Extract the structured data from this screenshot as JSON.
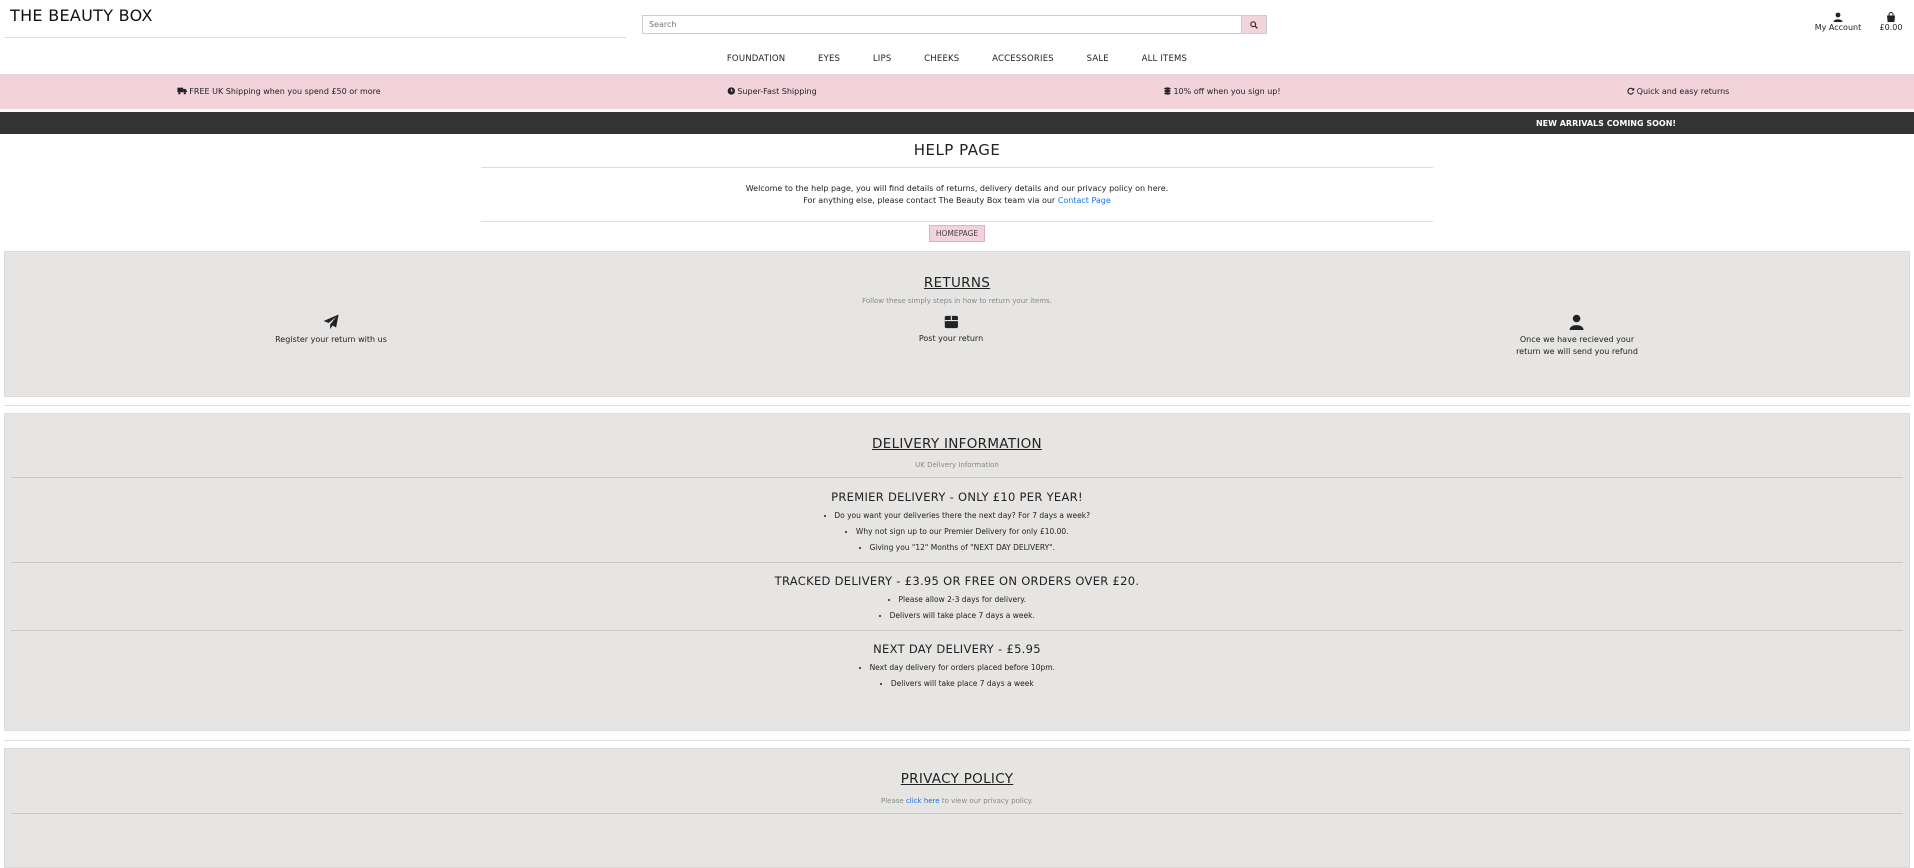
{
  "header": {
    "logo": "THE BEAUTY BOX",
    "search_placeholder": "Search",
    "account_label": "My Account",
    "bag_total": "£0.00"
  },
  "nav": [
    "FOUNDATION",
    "EYES",
    "LIPS",
    "CHEEKS",
    "ACCESSORIES",
    "SALE",
    "ALL ITEMS"
  ],
  "banner": {
    "shipping": "FREE UK Shipping when you spend £50 or more",
    "fast": "Super-Fast Shipping",
    "discount": "10% off when you sign up!",
    "returns": "Quick and easy returns"
  },
  "announcement": "NEW ARRIVALS COMING SOON!",
  "help": {
    "title": "HELP PAGE",
    "intro_line1": "Welcome to the help page, you will find details of returns, delivery details and our privacy policy on here.",
    "intro_line2_pre": "For anything else, please contact The Beauty Box team via our ",
    "contact_link": "Contact Page",
    "home_button": "HOMEPAGE"
  },
  "returns": {
    "title": "RETURNS",
    "subtitle": "Follow these simply steps in how to return your items.",
    "step1": "Register your return with us",
    "step2": "Post your return",
    "step3_line1": "Once we have recieved your",
    "step3_line2": "return we will send you refund"
  },
  "delivery": {
    "title": "DELIVERY INFORMATION",
    "subtitle": "UK Delivery Information",
    "premier": {
      "heading": "PREMIER DELIVERY - ONLY £10 PER YEAR!",
      "bullets": [
        "Do you want your deliveries there the next day? For 7 days a week?",
        "Why not sign up to our Premier Delivery for only £10.00.",
        "Giving you \"12\" Months of \"NEXT DAY DELIVERY\"."
      ]
    },
    "tracked": {
      "heading": "TRACKED DELIVERY - £3.95 OR FREE ON ORDERS OVER £20.",
      "bullets": [
        "Please allow 2-3 days for delivery.",
        "Delivers will take place 7 days a week."
      ]
    },
    "nextday": {
      "heading": "NEXT DAY DELIVERY - £5.95",
      "bullets": [
        "Next day delivery for orders placed before 10pm.",
        "Delivers will take place 7 days a week"
      ]
    }
  },
  "privacy": {
    "title": "PRIVACY POLICY",
    "text_pre": "Please ",
    "link": "click here",
    "text_post": " to view our privacy policy."
  },
  "colors": {
    "pink": "#f2d3dc",
    "dark_bar": "#333333",
    "panel": "#e6e5e3",
    "link": "#1a73e8"
  }
}
